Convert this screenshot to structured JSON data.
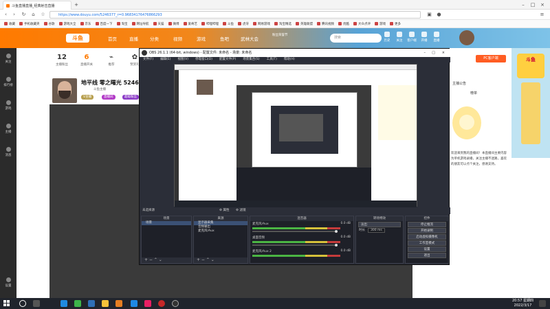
{
  "browser": {
    "tabs": [
      {
        "label": "斗鱼直播直播_经典射击直播"
      },
      {
        "label": "+"
      }
    ],
    "url": "https://www.douyu.com/5246377_r=0.96834176476866293",
    "bookmarks": [
      "收藏",
      "手机收藏夹",
      "谷歌",
      "游戏大全",
      "京东",
      "百度一下",
      "淘宝",
      "网址导航",
      "天猫",
      "微博",
      "爱奇艺",
      "哔哩哔哩",
      "斗鱼",
      "虎牙",
      "网易游戏",
      "淘宝精选",
      "英雄联盟",
      "腾讯视频",
      "优酷",
      "大众点评",
      "游戏",
      "更多"
    ]
  },
  "site": {
    "logo": "斗鱼",
    "nav": [
      "首页",
      "直播",
      "分类",
      "视频",
      "游戏",
      "鱼吧",
      "武林大会"
    ],
    "nav_badge": "粉丝荣誉节",
    "search_placeholder": "搜索",
    "header_icons": [
      "历史",
      "关注",
      "客户端",
      "开播",
      "直播"
    ],
    "pc_client": "PC客户端",
    "rail": [
      "关注",
      "排行榜",
      "游戏",
      "主播",
      "消息",
      "设置"
    ],
    "stats": [
      {
        "num": "12",
        "label": "主播粉丝"
      },
      {
        "num": "6",
        "label": "直播开关"
      },
      {
        "num": "",
        "label": "推荐"
      },
      {
        "num": "",
        "label": "赞赏礼"
      }
    ],
    "streamer_title": "地平线 零之曙光 524637",
    "streamer_sub": "斗鱼主播",
    "badge1": "V主播",
    "badge2": "直播间",
    "badge3": "超级粉丝",
    "right_tabs": [
      "主播公告",
      "榜单"
    ],
    "announce": "欢迎来到我的直播间！本直播间主要内容为单机游戏录播，关注主播不迷路，喜欢的朋友可以点个关注，感谢支持。",
    "ad_text": "斗鱼"
  },
  "obs": {
    "title": "OBS 26.1.1 (64-bit, windows) - 配置文件: 未命名 - 场景: 未命名",
    "menu": [
      "文件(F)",
      "编辑(E)",
      "视图(V)",
      "停靠窗口(D)",
      "配置文件(P)",
      "场景集合(S)",
      "工具(T)",
      "帮助(H)"
    ],
    "status": "未选择源",
    "panels": {
      "scenes": {
        "title": "场景",
        "items": [
          "场景"
        ]
      },
      "sources": {
        "title": "来源",
        "items": [
          "显示器采集",
          "音频输出",
          "麦克风/Aux"
        ]
      },
      "mixer": {
        "title": "混音器",
        "channels": [
          {
            "name": "麦克风/Aux",
            "db": "0.0 dB"
          },
          {
            "name": "桌面音频",
            "db": "0.0 dB"
          },
          {
            "name": "麦克风/Aux 2",
            "db": "0.0 dB"
          }
        ]
      },
      "transitions": {
        "title": "转场特效",
        "type": "淡出",
        "duration_label": "时长",
        "duration": "300 ms"
      },
      "controls": {
        "title": "控件",
        "buttons": [
          "停止推流",
          "开始录制",
          "启动虚拟摄像机",
          "工作室模式",
          "设置",
          "退出"
        ]
      }
    },
    "foot": "+ − ⌃ ⌄"
  },
  "taskbar": {
    "time": "20:57 星期四",
    "date": "2022/3/17"
  },
  "colors": {
    "brand_orange": "#ff7a00",
    "obs_dark": "#2b2e38",
    "pc_button": "#ff5d23"
  }
}
